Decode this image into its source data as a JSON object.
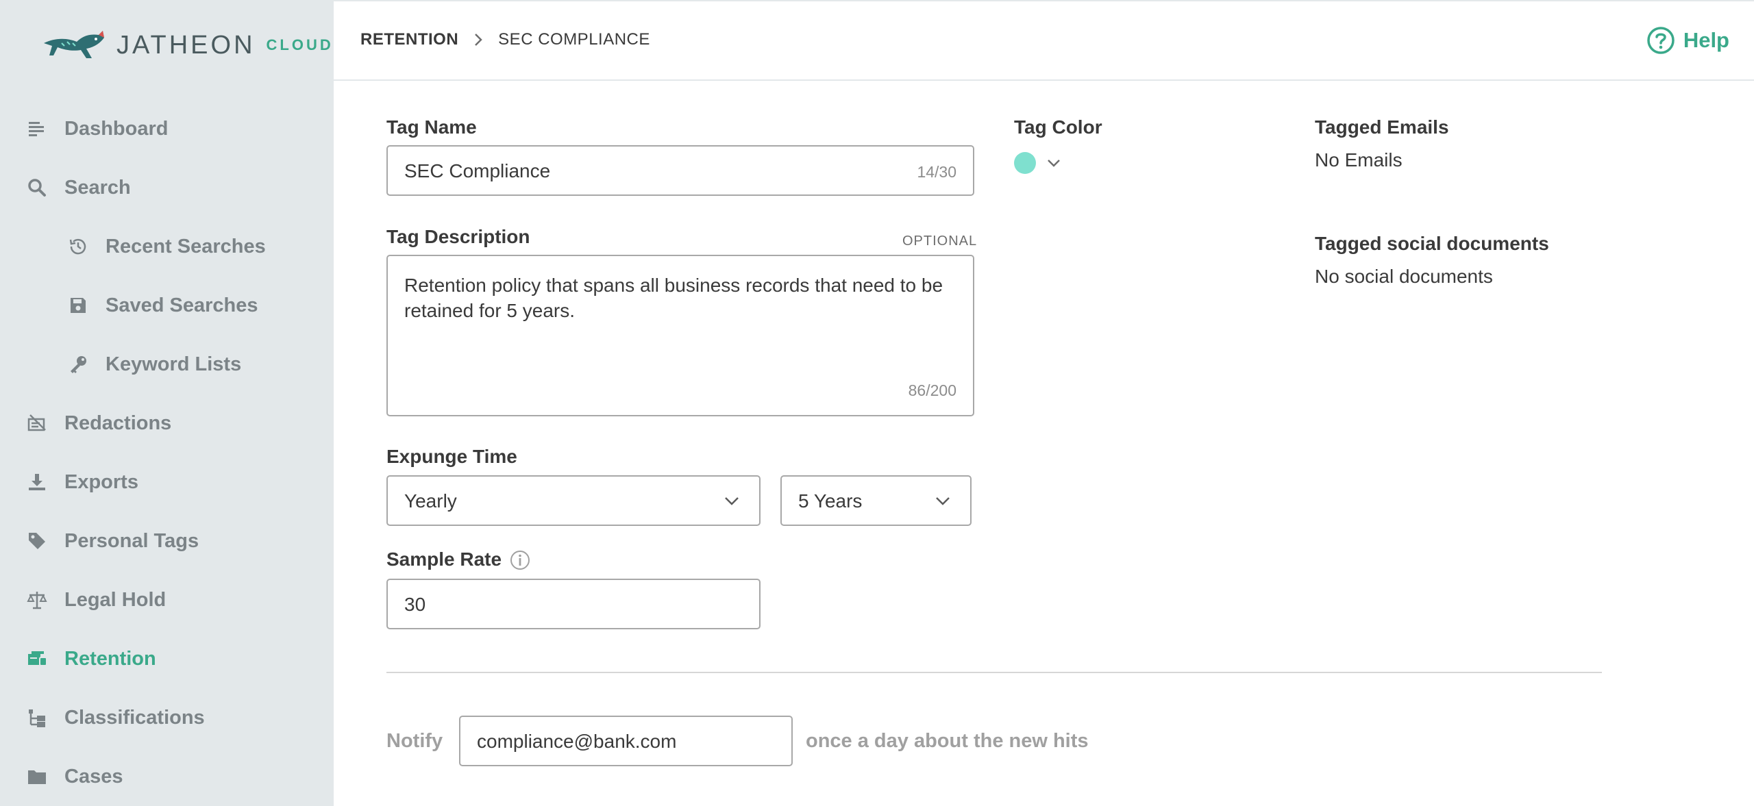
{
  "brand": {
    "logo_text": "JATHEON",
    "logo_suffix": "CLOUD"
  },
  "sidebar": {
    "items": [
      {
        "label": "Dashboard",
        "icon": "list-icon",
        "sub": false,
        "active": false
      },
      {
        "label": "Search",
        "icon": "search-icon",
        "sub": false,
        "active": false
      },
      {
        "label": "Recent Searches",
        "icon": "history-icon",
        "sub": true,
        "active": false
      },
      {
        "label": "Saved Searches",
        "icon": "floppy-disk-icon",
        "sub": true,
        "active": false
      },
      {
        "label": "Keyword Lists",
        "icon": "key-icon",
        "sub": true,
        "active": false
      },
      {
        "label": "Redactions",
        "icon": "redaction-icon",
        "sub": false,
        "active": false
      },
      {
        "label": "Exports",
        "icon": "download-icon",
        "sub": false,
        "active": false
      },
      {
        "label": "Personal Tags",
        "icon": "tag-icon",
        "sub": false,
        "active": false
      },
      {
        "label": "Legal Hold",
        "icon": "scale-icon",
        "sub": false,
        "active": false
      },
      {
        "label": "Retention",
        "icon": "retention-icon",
        "sub": false,
        "active": true
      },
      {
        "label": "Classifications",
        "icon": "hierarchy-icon",
        "sub": false,
        "active": false
      },
      {
        "label": "Cases",
        "icon": "folder-icon",
        "sub": false,
        "active": false
      }
    ]
  },
  "header": {
    "breadcrumb_root": "RETENTION",
    "breadcrumb_current": "SEC COMPLIANCE",
    "help_label": "Help"
  },
  "form": {
    "tag_name_label": "Tag Name",
    "tag_name_value": "SEC Compliance",
    "tag_name_counter": "14/30",
    "tag_description_label": "Tag Description",
    "tag_description_optional": "OPTIONAL",
    "tag_description_value": "Retention policy that spans all business records that need to be retained for 5 years.",
    "tag_description_counter": "86/200",
    "expunge_time_label": "Expunge Time",
    "expunge_frequency_value": "Yearly",
    "expunge_period_value": "5 Years",
    "sample_rate_label": "Sample Rate",
    "sample_rate_value": "30",
    "tag_color_label": "Tag Color",
    "tag_color_value": "#7fe0cf",
    "tagged_emails_label": "Tagged Emails",
    "tagged_emails_value": "No Emails",
    "tagged_social_label": "Tagged social documents",
    "tagged_social_value": "No social documents"
  },
  "notify": {
    "label": "Notify",
    "email_value": "compliance@bank.com",
    "tail": "once a day about the new hits"
  },
  "colors": {
    "accent": "#3aa98a",
    "sidebar_bg": "#e3e8ea",
    "muted": "#7b8387"
  }
}
